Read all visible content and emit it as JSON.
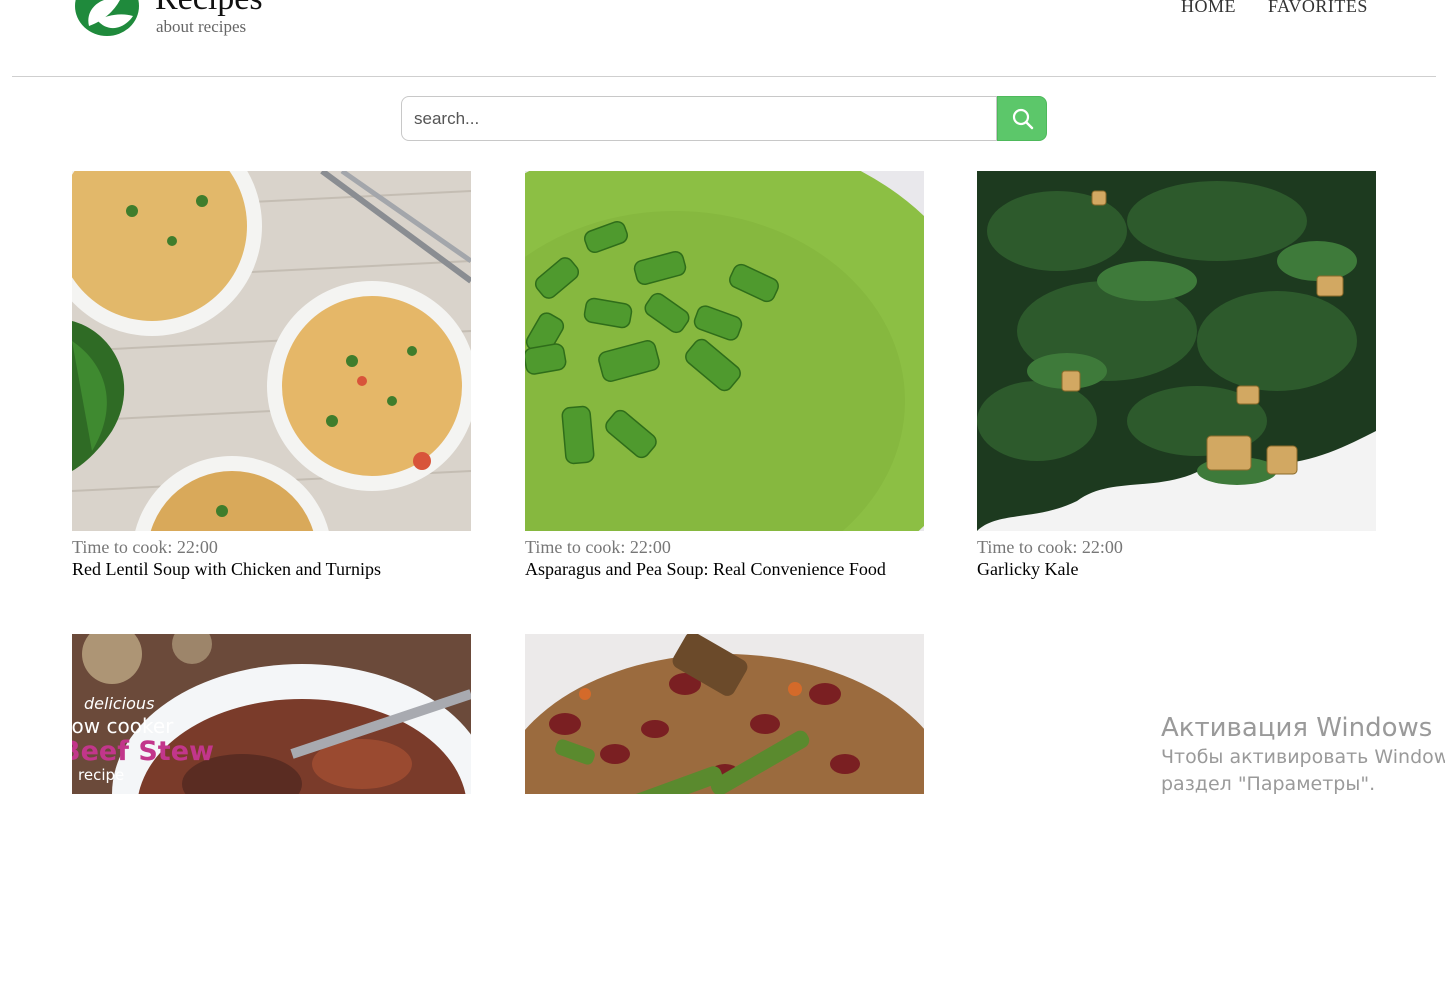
{
  "site": {
    "title": "Recipes",
    "tagline": "about recipes",
    "brand_color": "#1f8a3c"
  },
  "nav": {
    "home": "HOME",
    "favorites": "FAVORITES"
  },
  "search": {
    "placeholder": "search...",
    "value": "",
    "button_icon": "search-icon",
    "button_color": "#5cc76a"
  },
  "recipes": [
    {
      "time_label": "Time to cook: 22:00",
      "title": "Red Lentil Soup with Chicken and Turnips"
    },
    {
      "time_label": "Time to cook: 22:00",
      "title": "Asparagus and Pea Soup: Real Convenience Food"
    },
    {
      "time_label": "Time to cook: 22:00",
      "title": "Garlicky Kale"
    },
    {
      "time_label": "",
      "title": "",
      "image_text": [
        "delicious",
        "low cooker",
        "Beef Stew",
        "recipe"
      ]
    },
    {
      "time_label": "",
      "title": ""
    }
  ],
  "watermark": {
    "title": "Активация Windows",
    "line1": "Чтобы активировать Windows,",
    "line2": "раздел \"Параметры\"."
  }
}
